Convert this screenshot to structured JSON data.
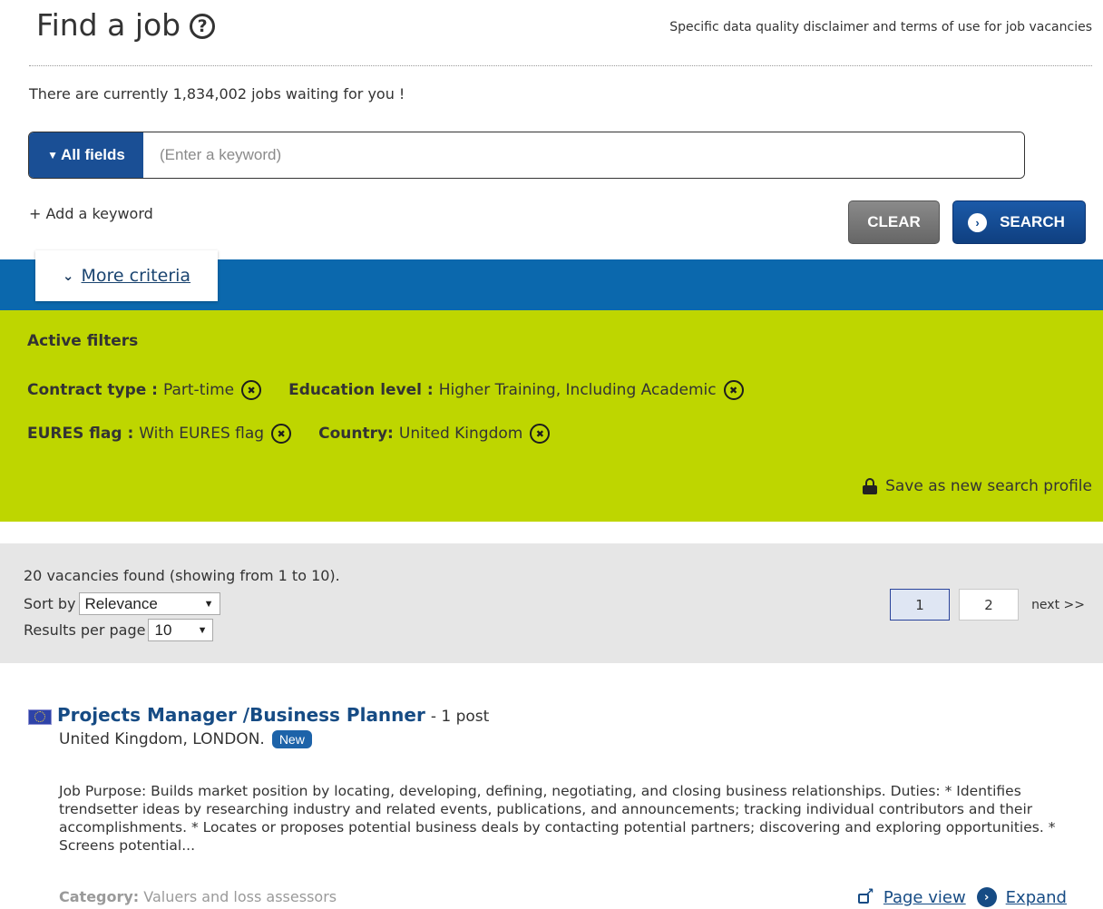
{
  "header": {
    "title": "Find a job",
    "help_icon": "question-circle-icon",
    "disclaimer": "Specific data quality disclaimer and terms of use for job vacancies"
  },
  "jobs_count_text": "There are currently 1,834,002 jobs waiting for you !",
  "search": {
    "field_label": "All fields",
    "placeholder": "(Enter a keyword)",
    "value": "",
    "add_keyword": "+ Add a keyword",
    "clear_label": "CLEAR",
    "search_label": "SEARCH"
  },
  "more_criteria": {
    "label": "More criteria"
  },
  "filters": {
    "title": "Active filters",
    "items": [
      {
        "key": "Contract type :",
        "value": "Part-time"
      },
      {
        "key": "Education level :",
        "value": "Higher Training, Including Academic"
      },
      {
        "key": "EURES flag :",
        "value": "With EURES flag"
      },
      {
        "key": "Country:",
        "value": "United Kingdom"
      }
    ],
    "save_profile": "Save as new search profile"
  },
  "results": {
    "summary": "20 vacancies found (showing from 1 to 10).",
    "sort_label": "Sort by",
    "sort_value": "Relevance",
    "per_page_label": "Results per page",
    "per_page_value": "10",
    "pages": [
      "1",
      "2"
    ],
    "current_page": "1",
    "next_label": "next >>"
  },
  "job": {
    "title": "Projects Manager /Business Planner",
    "posts": "- 1 post",
    "location": "United Kingdom, LONDON.",
    "badge": "New",
    "description": "Job Purpose: Builds market position by locating, developing, defining, negotiating, and closing business relationships. Duties: * Identifies trendsetter ideas by researching industry and related events, publications, and announcements; tracking individual contributors and their accomplishments. * Locates or proposes potential business deals by contacting potential partners; discovering and exploring opportunities. * Screens potential...",
    "category_label": "Category:",
    "category_value": "Valuers and loss assessors",
    "page_view_label": "Page view",
    "expand_label": "Expand"
  },
  "colors": {
    "blue_band": "#0b68ad",
    "filter_green": "#bed600",
    "brand_dark_blue": "#1a4f95",
    "results_gray": "#e6e6e6"
  }
}
